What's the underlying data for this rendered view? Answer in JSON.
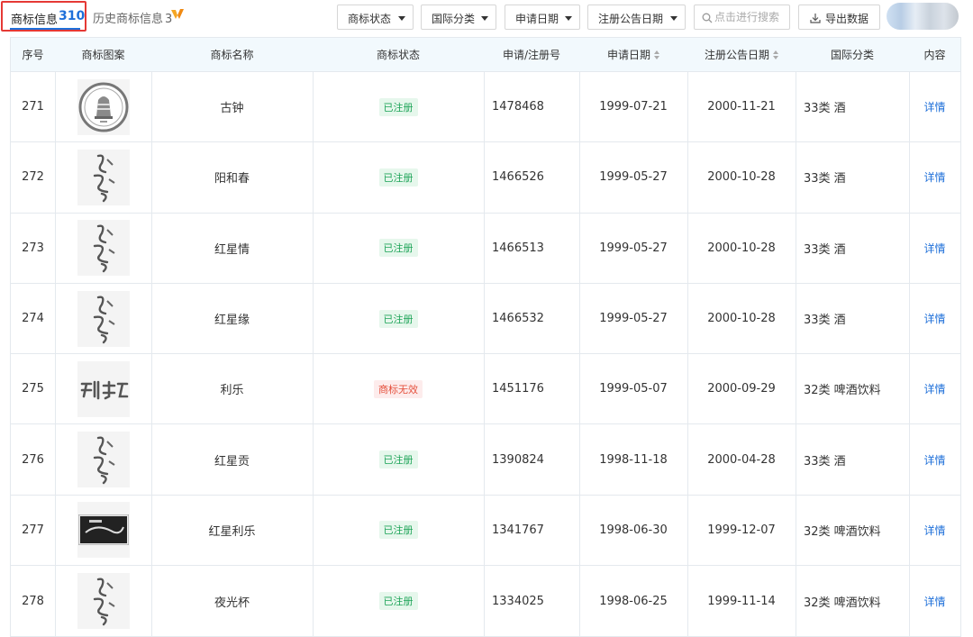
{
  "tabs": {
    "active_label": "商标信息",
    "active_count": "310",
    "history_label": "历史商标信息",
    "history_count": "3"
  },
  "filters": {
    "status": "商标状态",
    "intl_class": "国际分类",
    "apply_date": "申请日期",
    "reg_date": "注册公告日期"
  },
  "search": {
    "placeholder": "点击进行搜索"
  },
  "export": {
    "label": "导出数据"
  },
  "table": {
    "headers": {
      "index": "序号",
      "image": "商标图案",
      "name": "商标名称",
      "status": "商标状态",
      "reg_no": "申请/注册号",
      "apply_date": "申请日期",
      "reg_date": "注册公告日期",
      "intl_class": "国际分类",
      "content": "内容"
    },
    "rows": [
      {
        "index": "271",
        "name": "古钟",
        "status": "已注册",
        "status_type": "ok",
        "reg_no": "1478468",
        "apply_date": "1999-07-21",
        "reg_date": "2000-11-21",
        "intl_class": "33类 酒",
        "action": "详情",
        "logo_icon": "bell-seal-logo"
      },
      {
        "index": "272",
        "name": "阳和春",
        "status": "已注册",
        "status_type": "ok",
        "reg_no": "1466526",
        "apply_date": "1999-05-27",
        "reg_date": "2000-10-28",
        "intl_class": "33类 酒",
        "action": "详情",
        "logo_icon": "calligraphy-logo"
      },
      {
        "index": "273",
        "name": "红星情",
        "status": "已注册",
        "status_type": "ok",
        "reg_no": "1466513",
        "apply_date": "1999-05-27",
        "reg_date": "2000-10-28",
        "intl_class": "33类 酒",
        "action": "详情",
        "logo_icon": "calligraphy-logo"
      },
      {
        "index": "274",
        "name": "红星缘",
        "status": "已注册",
        "status_type": "ok",
        "reg_no": "1466532",
        "apply_date": "1999-05-27",
        "reg_date": "2000-10-28",
        "intl_class": "33类 酒",
        "action": "详情",
        "logo_icon": "calligraphy-logo"
      },
      {
        "index": "275",
        "name": "利乐",
        "status": "商标无效",
        "status_type": "bad",
        "reg_no": "1451176",
        "apply_date": "1999-05-07",
        "reg_date": "2000-09-29",
        "intl_class": "32类 啤酒饮料",
        "action": "详情",
        "logo_icon": "wordmark-logo"
      },
      {
        "index": "276",
        "name": "红星贡",
        "status": "已注册",
        "status_type": "ok",
        "reg_no": "1390824",
        "apply_date": "1998-11-18",
        "reg_date": "2000-04-28",
        "intl_class": "33类 酒",
        "action": "详情",
        "logo_icon": "calligraphy-logo"
      },
      {
        "index": "277",
        "name": "红星利乐",
        "status": "已注册",
        "status_type": "ok",
        "reg_no": "1341767",
        "apply_date": "1998-06-30",
        "reg_date": "1999-12-07",
        "intl_class": "32类 啤酒饮料",
        "action": "详情",
        "logo_icon": "label-logo"
      },
      {
        "index": "278",
        "name": "夜光杯",
        "status": "已注册",
        "status_type": "ok",
        "reg_no": "1334025",
        "apply_date": "1998-06-25",
        "reg_date": "1999-11-14",
        "intl_class": "32类 啤酒饮料",
        "action": "详情",
        "logo_icon": "calligraphy-logo"
      }
    ]
  },
  "colors": {
    "accent": "#1e6fd9",
    "highlight_border": "#e53935",
    "header_bg": "#f2f9fd",
    "status_ok": "#20a55a",
    "status_bad": "#e5503c"
  }
}
